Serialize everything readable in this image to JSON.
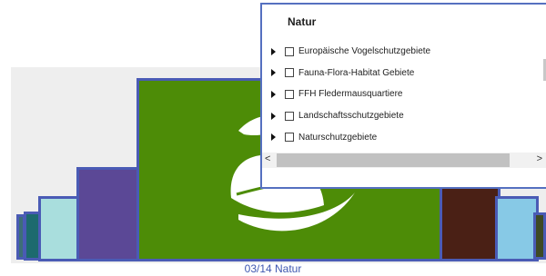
{
  "popup": {
    "title": "Natur",
    "layers": [
      {
        "label": "Europäische Vogelschutzgebiete"
      },
      {
        "label": "Fauna-Flora-Habitat Gebiete"
      },
      {
        "label": "FFH Fledermausquartiere"
      },
      {
        "label": "Landschaftsschutzgebiete"
      },
      {
        "label": "Naturschutzgebiete"
      }
    ],
    "scroll_left": "<",
    "scroll_right": ">"
  },
  "carousel": {
    "caption": "03/14 Natur",
    "main_icon": "leaf-icon",
    "colors": {
      "main": "#4d8c07",
      "border": "#4a5bb5"
    }
  }
}
